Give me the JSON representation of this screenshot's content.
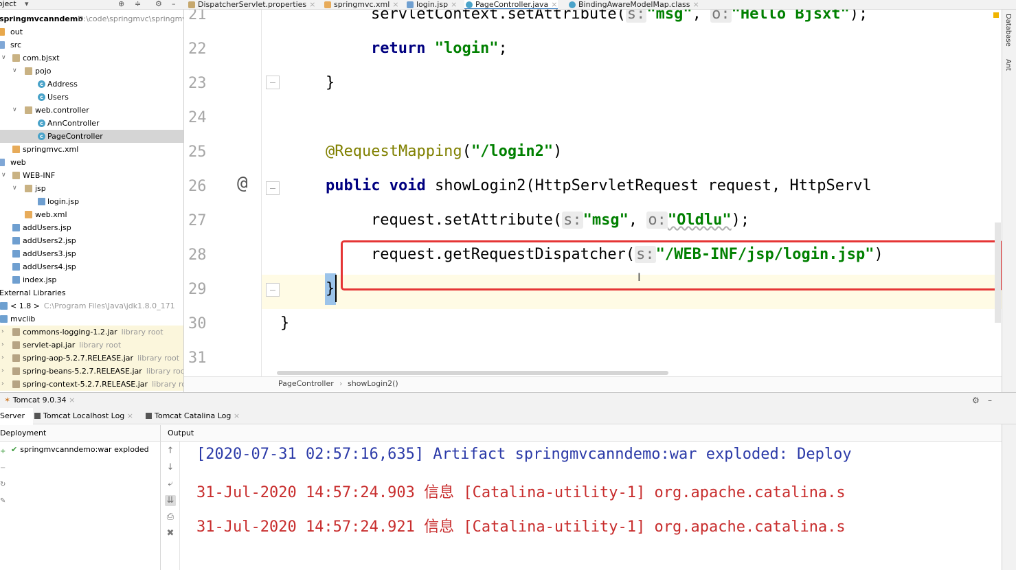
{
  "project_panel": {
    "title": "Project",
    "root_label": "springmvcanndemo",
    "root_path": "D:\\code\\springmvc\\springmv",
    "items": [
      {
        "label": "out",
        "hint": ""
      },
      {
        "label": "src",
        "hint": ""
      },
      {
        "label": "com.bjsxt",
        "hint": ""
      },
      {
        "label": "pojo",
        "hint": ""
      },
      {
        "label": "Address",
        "hint": ""
      },
      {
        "label": "Users",
        "hint": ""
      },
      {
        "label": "web.controller",
        "hint": ""
      },
      {
        "label": "AnnController",
        "hint": ""
      },
      {
        "label": "PageController",
        "hint": ""
      },
      {
        "label": "springmvc.xml",
        "hint": ""
      },
      {
        "label": "web",
        "hint": ""
      },
      {
        "label": "WEB-INF",
        "hint": ""
      },
      {
        "label": "jsp",
        "hint": ""
      },
      {
        "label": "login.jsp",
        "hint": ""
      },
      {
        "label": "web.xml",
        "hint": ""
      },
      {
        "label": "addUsers.jsp",
        "hint": ""
      },
      {
        "label": "addUsers2.jsp",
        "hint": ""
      },
      {
        "label": "addUsers3.jsp",
        "hint": ""
      },
      {
        "label": "addUsers4.jsp",
        "hint": ""
      },
      {
        "label": "index.jsp",
        "hint": ""
      },
      {
        "label": "External Libraries",
        "hint": ""
      },
      {
        "label": "< 1.8 >",
        "hint": "C:\\Program Files\\Java\\jdk1.8.0_171"
      },
      {
        "label": "mvclib",
        "hint": ""
      },
      {
        "label": "commons-logging-1.2.jar",
        "hint": "library root"
      },
      {
        "label": "servlet-api.jar",
        "hint": "library root"
      },
      {
        "label": "spring-aop-5.2.7.RELEASE.jar",
        "hint": "library root"
      },
      {
        "label": "spring-beans-5.2.7.RELEASE.jar",
        "hint": "library root"
      },
      {
        "label": "spring-context-5.2.7.RELEASE.jar",
        "hint": "library root"
      }
    ]
  },
  "editor_tabs": [
    {
      "label": "DispatcherServlet.properties"
    },
    {
      "label": "springmvc.xml"
    },
    {
      "label": "login.jsp"
    },
    {
      "label": "PageController.java"
    },
    {
      "label": "BindingAwareModelMap.class"
    }
  ],
  "editor": {
    "line_numbers": [
      "21",
      "22",
      "23",
      "24",
      "25",
      "26",
      "27",
      "28",
      "29",
      "30",
      "31"
    ],
    "line21": {
      "a": "servletContext.setAttribute(",
      "h1": "s:",
      "s1": "\"msg\"",
      "c": ", ",
      "h2": "o:",
      "s2": "\"Hello Bjsxt\"",
      "e": ");"
    },
    "line22": {
      "kw": "return",
      "s": "\"login\"",
      "e": ";"
    },
    "line23": "}",
    "line25": {
      "ann": "@RequestMapping",
      "p1": "(",
      "s": "\"/login2\"",
      "p2": ")"
    },
    "line26": {
      "kw1": "public",
      "kw2": "void",
      "rest": "showLogin2(HttpServletRequest request, HttpServl"
    },
    "line27": {
      "a": "request.setAttribute(",
      "h1": "s:",
      "s1": "\"msg\"",
      "c": ", ",
      "h2": "o:",
      "s2": "\"Oldlu\"",
      "e": ");"
    },
    "line28": {
      "a": "request.getRequestDispatcher(",
      "h1": "s:",
      "s1": "\"/WEB-INF/jsp/login.jsp\"",
      "e": ")"
    },
    "line29": "}",
    "line30": "}",
    "at_marker": "@"
  },
  "breadcrumb": {
    "class": "PageController",
    "sep": "›",
    "method": "showLogin2()"
  },
  "right_strip": {
    "database": "Database",
    "ant": "Ant"
  },
  "run_panel": {
    "title": "Tomcat 9.0.34",
    "tabs": [
      {
        "label": "Server"
      },
      {
        "label": "Tomcat Localhost Log"
      },
      {
        "label": "Tomcat Catalina Log"
      }
    ],
    "deployment_label": "Deployment",
    "output_label": "Output",
    "deployment_item": "springmvcanndemo:war exploded",
    "console_lines": [
      "[2020-07-31 02:57:16,635] Artifact springmvcanndemo:war exploded: Deploy",
      "31-Jul-2020 14:57:24.903 信息 [Catalina-utility-1] org.apache.catalina.s",
      "31-Jul-2020 14:57:24.921 信息 [Catalina-utility-1] org.apache.catalina.s"
    ]
  },
  "colors": {
    "accent": "#4a88c7",
    "highlight_box": "#e53535",
    "keyword": "#000080",
    "string": "#008000",
    "annotation": "#808000"
  }
}
